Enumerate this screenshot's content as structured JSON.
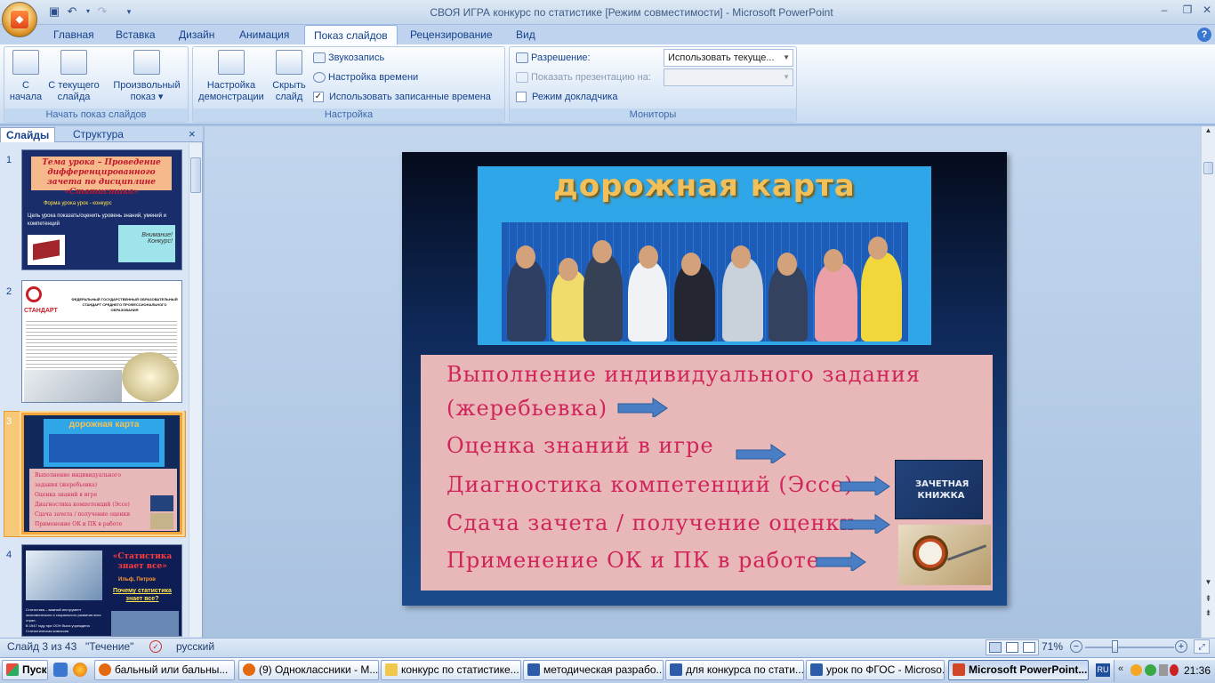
{
  "window": {
    "title": "СВОЯ ИГРА конкурс по статистике [Режим совместимости] - Microsoft PowerPoint"
  },
  "tabs": [
    "Главная",
    "Вставка",
    "Дизайн",
    "Анимация",
    "Показ слайдов",
    "Рецензирование",
    "Вид"
  ],
  "active_tab": "Показ слайдов",
  "ribbon": {
    "start_group": {
      "label": "Начать показ слайдов",
      "from_start": [
        "С",
        "начала"
      ],
      "from_current": [
        "С текущего",
        "слайда"
      ],
      "custom": [
        "Произвольный",
        "показ ▾"
      ]
    },
    "setup_group": {
      "label": "Настройка",
      "setup_show": [
        "Настройка",
        "демонстрации"
      ],
      "hide_slide": [
        "Скрыть",
        "слайд"
      ],
      "record_narration": "Звукозапись",
      "rehearse_timings": "Настройка времени",
      "use_timings": "Использовать записанные времена",
      "use_timings_checked": true
    },
    "monitors_group": {
      "label": "Мониторы",
      "resolution_label": "Разрешение:",
      "resolution_value": "Использовать текуще...",
      "show_on_label": "Показать презентацию на:",
      "show_on_value": "",
      "presenter_view": "Режим докладчика",
      "presenter_view_checked": false
    }
  },
  "pane": {
    "tab_slides": "Слайды",
    "tab_outline": "Структура",
    "close": "×",
    "thumbs": [
      {
        "num": "1",
        "title": "Тема урока – Проведение дифференцированного зачета по дисциплине «Статистика»",
        "line1": "Форма урока        урок - конкурс",
        "line2": "Цель урока   показать/оценить  уровень  знаний, умений и компетенций",
        "sticker": "Внимание! Конкурс!"
      },
      {
        "num": "2",
        "logo": "СТАНДАРТ",
        "heading": "ФЕДЕРАЛЬНЫЙ ГОСУДАРСТВЕННЫЙ ОБРАЗОВАТЕЛЬНЫЙ СТАНДАРТ СРЕДНЕГО ПРОФЕССИОНАЛЬНОГО ОБРАЗОВАНИЯ"
      },
      {
        "num": "3",
        "title": "дорожная карта",
        "items": [
          "Выполнение  индивидуального  задания (жеребьевка)",
          "Оценка знаний   в  игре",
          "Диагностика   компетенций  (Эссе)",
          "Сдача зачета  /  получение  оценки",
          "Применение  ОК и ПК в работе"
        ]
      },
      {
        "num": "4",
        "title": "«Статистика знает все»",
        "author": "Ильф, Петров",
        "subtitle": "Почему статистика знает все?",
        "body": "Статистика – важный инструмент экономического и социального развития всех стран.",
        "body2": "В 1947 году при ООН была учреждена Статистическая комиссия"
      }
    ]
  },
  "slide": {
    "title": "дорожная карта",
    "items": [
      "Выполнение  индивидуального   задания",
      "(жеребьевка)",
      "Оценка знаний   в  игре",
      "Диагностика  компетенций (Эссе)",
      "Сдача зачета / получение оценки",
      "Применение  ОК и ПК в работе"
    ],
    "book_text": "ЗАЧЕТНАЯ КНИЖКА"
  },
  "status": {
    "slide_counter": "Слайд 3 из 43",
    "theme": "\"Течение\"",
    "language": "русский",
    "zoom": "71%"
  },
  "taskbar": {
    "start": "Пуск",
    "items": [
      "бальный или бальны...",
      "(9) Одноклассники - М...",
      "конкурс по статистике...",
      "методическая разрабо...",
      "для конкурса по стати...",
      "урок по ФГОС - Microso...",
      "Microsoft PowerPoint..."
    ],
    "lang": "RU",
    "clock": "21:36"
  },
  "colors": {
    "accent": "#15428b",
    "slide_text": "#d0245a",
    "list_bg": "#e8b8b8",
    "banner_bg": "#2fa6e8",
    "title_gold": "#f2c05a"
  }
}
